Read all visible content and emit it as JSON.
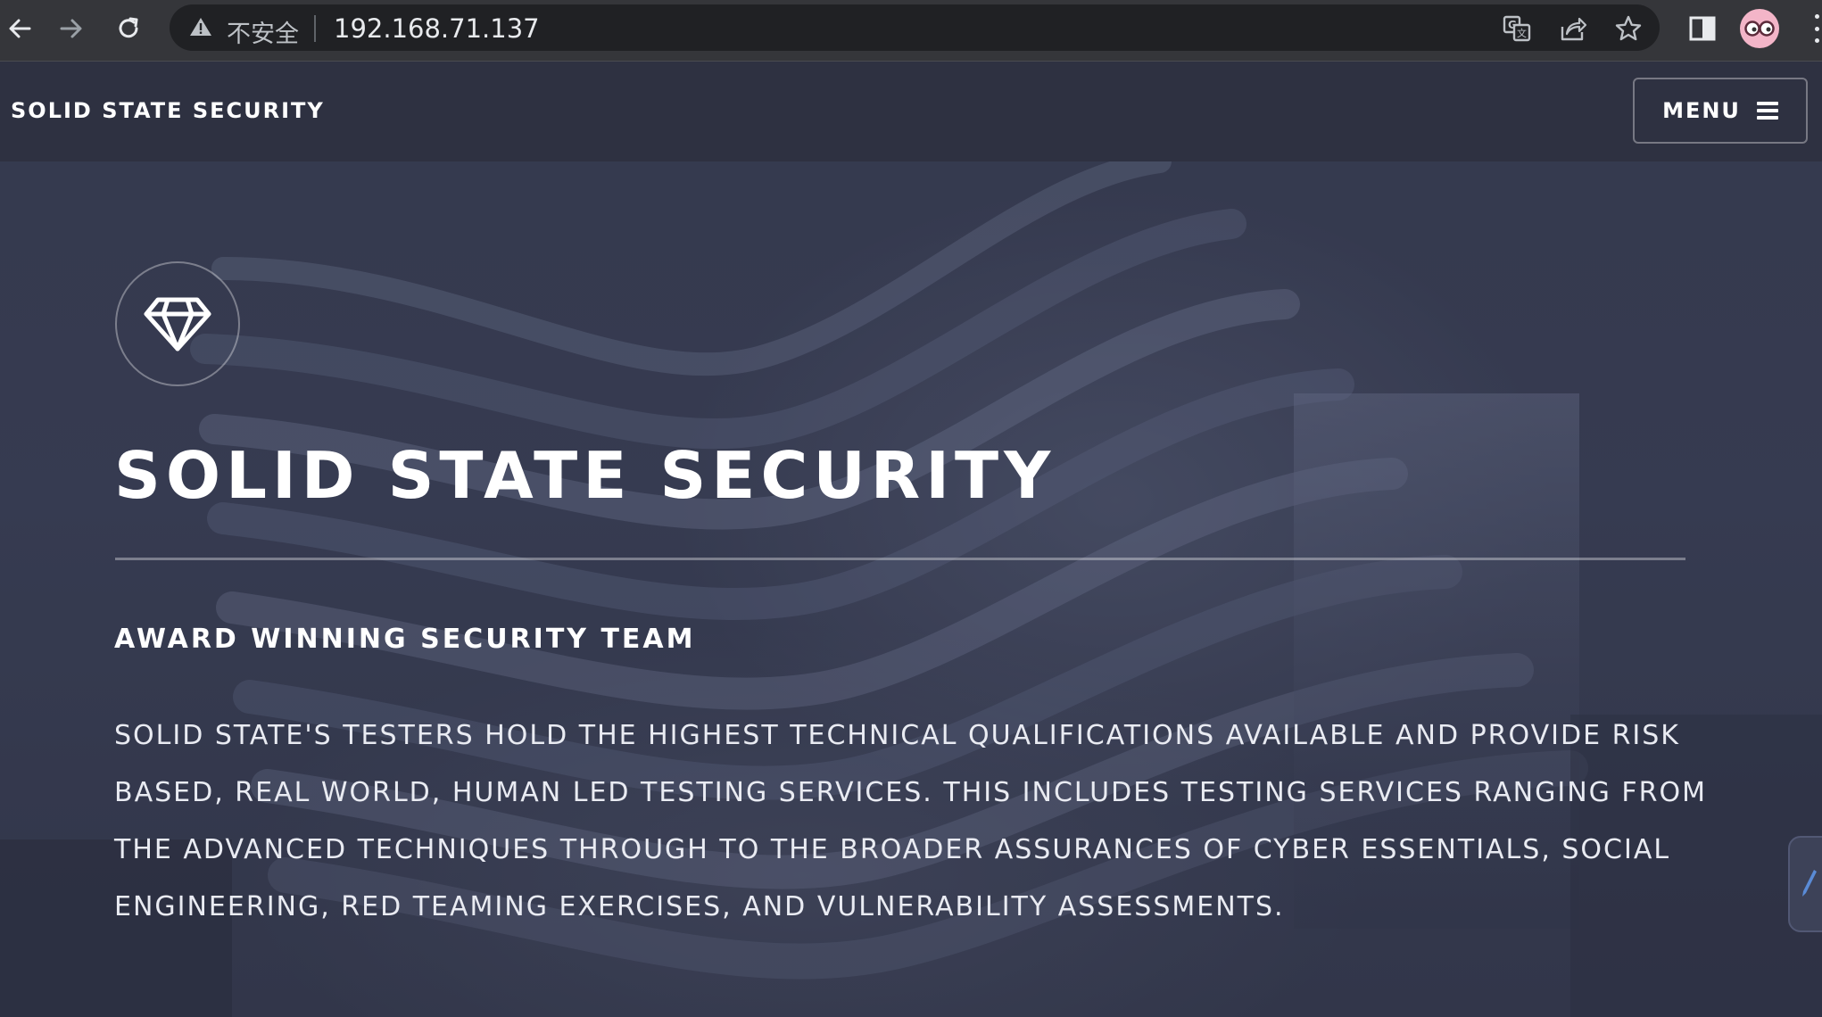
{
  "browser": {
    "security_label": "不安全",
    "url": "192.168.71.137",
    "icons": {
      "back": "arrow-left-icon",
      "forward": "arrow-right-icon",
      "reload": "reload-icon",
      "warning": "warning-triangle-icon",
      "translate": "translate-icon",
      "share": "share-icon",
      "bookmark": "star-icon",
      "side_panel": "side-panel-icon",
      "profile": "avatar",
      "menu": "kebab-menu-icon"
    }
  },
  "header": {
    "site_title": "SOLID STATE SECURITY",
    "menu_label": "MENU"
  },
  "banner": {
    "logo_icon": "diamond-icon",
    "title": "SOLID STATE SECURITY",
    "subtitle": "AWARD WINNING SECURITY TEAM",
    "body": "SOLID STATE'S TESTERS HOLD THE HIGHEST TECHNICAL QUALIFICATIONS AVAILABLE AND PROVIDE RISK BASED, REAL WORLD, HUMAN LED TESTING SERVICES. THIS INCLUDES TESTING SERVICES RANGING FROM THE ADVANCED TECHNIQUES THROUGH TO THE BROADER ASSURANCES OF CYBER ESSENTIALS, SOCIAL ENGINEERING, RED TEAMING EXERCISES, AND VULNERABILITY ASSESSMENTS."
  },
  "colors": {
    "header_bg": "#2e3141",
    "chrome_bg": "#35363a",
    "omnibox_bg": "#202124",
    "text": "#ffffff",
    "avatar_bg": "#f3b5c8"
  }
}
